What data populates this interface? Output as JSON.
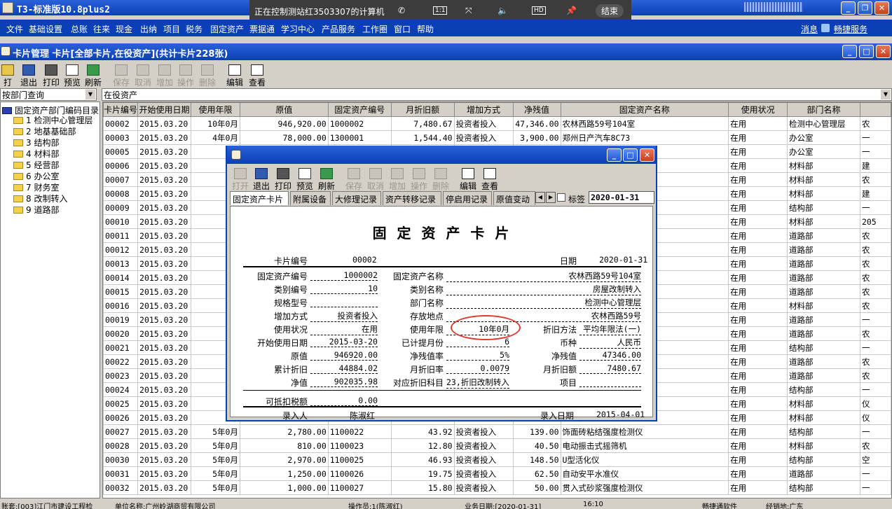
{
  "app": {
    "title": "T3-标准版10.8plus2"
  },
  "remote": {
    "text": "正在控制测站红3503307的计算机",
    "end": "结束"
  },
  "menu": [
    "文件",
    "基础设置",
    "总账",
    "往来",
    "现金",
    "出纳",
    "项目",
    "税务",
    "固定资产",
    "票据通",
    "学习中心",
    "产品服务",
    "工作圈",
    "窗口",
    "帮助"
  ],
  "menu_right": {
    "msg": "消息",
    "service": "畅捷服务"
  },
  "card_window": {
    "title": "卡片管理  卡片[全部卡片,在役资产](共计卡片228张)"
  },
  "toolbar": {
    "open": "打开",
    "exit": "退出",
    "print": "打印",
    "preview": "预览",
    "refresh": "刷新",
    "save": "保存",
    "cancel": "取消",
    "add": "增加",
    "operate": "操作",
    "delete": "删除",
    "edit": "编辑",
    "view": "查看"
  },
  "left_select": "按部门查询",
  "right_select": "在役资产",
  "tree": {
    "root": "固定资产部门编码目录",
    "items": [
      "1 检测中心管理层",
      "2 地基基础部",
      "3 结构部",
      "4 材料部",
      "5 经营部",
      "6 办公室",
      "7 财务室",
      "8 改制转入",
      "9 道路部"
    ]
  },
  "grid": {
    "headers": [
      "卡片编号",
      "开始使用日期",
      "使用年限",
      "原值",
      "固定资产编号",
      "月折旧额",
      "增加方式",
      "净残值",
      "固定资产名称",
      "使用状况",
      "部门名称",
      ""
    ],
    "rows": [
      [
        "00002",
        "2015.03.20",
        "10年0月",
        "946,920.00",
        "1000002",
        "7,480.67",
        "投资者投入",
        "47,346.00",
        "农林西路59号104室",
        "在用",
        "检测中心管理层",
        "农"
      ],
      [
        "00003",
        "2015.03.20",
        "4年0月",
        "78,000.00",
        "1300001",
        "1,544.40",
        "投资者投入",
        "3,900.00",
        "郑州日产汽车8C73",
        "在用",
        "办公室",
        "一"
      ],
      [
        "00005",
        "2015.03.20",
        "5年",
        "",
        "",
        "",
        "",
        "",
        "",
        "在用",
        "办公室",
        "一"
      ],
      [
        "00006",
        "2015.03.20",
        "5年",
        "",
        "",
        "",
        "",
        "",
        "",
        "在用",
        "材料部",
        "建"
      ],
      [
        "00007",
        "2015.03.20",
        "5年",
        "",
        "",
        "",
        "",
        "",
        "试验机",
        "在用",
        "材料部",
        "农"
      ],
      [
        "00008",
        "2015.03.20",
        "5年",
        "",
        "",
        "",
        "",
        "",
        "",
        "在用",
        "材料部",
        "建"
      ],
      [
        "00009",
        "2015.03.20",
        "5年",
        "",
        "",
        "",
        "",
        "",
        "测仪",
        "在用",
        "结构部",
        "一"
      ],
      [
        "00010",
        "2015.03.20",
        "5年",
        "",
        "",
        "",
        "",
        "",
        "比测试系统",
        "在用",
        "材料部",
        "205"
      ],
      [
        "00011",
        "2015.03.20",
        "5年",
        "",
        "",
        "",
        "",
        "",
        "",
        "在用",
        "道路部",
        "农"
      ],
      [
        "00012",
        "2015.03.20",
        "5年",
        "",
        "",
        "",
        "",
        "",
        "",
        "在用",
        "道路部",
        "农"
      ],
      [
        "00013",
        "2015.03.20",
        "5年",
        "",
        "",
        "",
        "",
        "",
        "",
        "在用",
        "道路部",
        "农"
      ],
      [
        "00014",
        "2015.03.20",
        "5年",
        "",
        "",
        "",
        "",
        "",
        "仪",
        "在用",
        "道路部",
        "农"
      ],
      [
        "00015",
        "2015.03.20",
        "5年",
        "",
        "",
        "",
        "",
        "",
        "箱",
        "在用",
        "道路部",
        "农"
      ],
      [
        "00016",
        "2015.03.20",
        "5年",
        "",
        "",
        "",
        "",
        "",
        "",
        "在用",
        "材料部",
        "农"
      ],
      [
        "00019",
        "2015.03.20",
        "5年",
        "",
        "",
        "",
        "",
        "",
        "(钻芯法)",
        "在用",
        "道路部",
        "一"
      ],
      [
        "00020",
        "2015.03.20",
        "5年",
        "",
        "",
        "",
        "",
        "",
        "",
        "在用",
        "道路部",
        "农"
      ],
      [
        "00021",
        "2015.03.20",
        "5年",
        "",
        "",
        "",
        "",
        "",
        "",
        "在用",
        "结构部",
        "一"
      ],
      [
        "00022",
        "2015.03.20",
        "5年",
        "",
        "",
        "",
        "",
        "",
        "",
        "在用",
        "道路部",
        "农"
      ],
      [
        "00023",
        "2015.03.20",
        "5年",
        "",
        "",
        "",
        "",
        "",
        "",
        "在用",
        "道路部",
        "农"
      ],
      [
        "00024",
        "2015.03.20",
        "5年",
        "",
        "",
        "",
        "",
        "",
        "检测仪",
        "在用",
        "结构部",
        "一"
      ],
      [
        "00025",
        "2015.03.20",
        "5年",
        "",
        "",
        "",
        "",
        "",
        "",
        "在用",
        "材料部",
        "仪"
      ],
      [
        "00026",
        "2015.03.20",
        "5年",
        "",
        "",
        "",
        "",
        "",
        "系数检定系统",
        "在用",
        "材料部",
        "仪"
      ],
      [
        "00027",
        "2015.03.20",
        "5年0月",
        "2,780.00",
        "1100022",
        "43.92",
        "投资者投入",
        "139.00",
        "饰面砖粘结强度检测仪",
        "在用",
        "结构部",
        "一"
      ],
      [
        "00028",
        "2015.03.20",
        "5年0月",
        "810.00",
        "1100023",
        "12.80",
        "投资者投入",
        "40.50",
        "电动振击式摇筛机",
        "在用",
        "材料部",
        "农"
      ],
      [
        "00030",
        "2015.03.20",
        "5年0月",
        "2,970.00",
        "1100025",
        "46.93",
        "投资者投入",
        "148.50",
        "U型活化仪",
        "在用",
        "结构部",
        "空"
      ],
      [
        "00031",
        "2015.03.20",
        "5年0月",
        "1,250.00",
        "1100026",
        "19.75",
        "投资者投入",
        "62.50",
        "自动安平水准仪",
        "在用",
        "道路部",
        "一"
      ],
      [
        "00032",
        "2015.03.20",
        "5年0月",
        "1,000.00",
        "1100027",
        "15.80",
        "投资者投入",
        "50.00",
        "贯入式砂浆强度检测仪",
        "在用",
        "结构部",
        "一"
      ]
    ]
  },
  "status": {
    "account": "账套:[003]江门市建设工程检",
    "company": "单位名称:广州岭湖商贸有限公司",
    "operator": "操作员:1(陈淑红)",
    "date": "业务日期:[2020-01-31]",
    "time": "16:10",
    "soft": "畅捷通软件",
    "dealer": "经销地:广东"
  },
  "dialog": {
    "tabs": [
      "固定资产卡片",
      "附属设备",
      "大修理记录",
      "资产转移记录",
      "停启用记录",
      "原值变动"
    ],
    "tag_label": "标签",
    "tag_date": "2020-01-31",
    "card_title": "固 定 资 产 卡 片",
    "card_no_label": "卡片编号",
    "card_no": "00002",
    "date_label": "日期",
    "date": "2020-01-31",
    "fields": {
      "asset_no_l": "固定资产编号",
      "asset_no": "1000002",
      "asset_name_l": "固定资产名称",
      "asset_name": "农林西路59号104室",
      "cat_no_l": "类别编号",
      "cat_no": "10",
      "cat_name_l": "类别名称",
      "cat_name": "房屋改制转入",
      "spec_l": "规格型号",
      "spec": "",
      "dept_l": "部门名称",
      "dept": "检测中心管理层",
      "add_l": "增加方式",
      "add": "投资者投入",
      "loc_l": "存放地点",
      "loc": "农林西路59号",
      "status_l": "使用状况",
      "status": "在用",
      "life_l": "使用年限",
      "life": "10年0月",
      "method_l": "折旧方法",
      "method": "平均年限法(一)",
      "start_l": "开始使用日期",
      "start": "2015-03-20",
      "months_l": "已计提月份",
      "months": "6",
      "cur_l": "币种",
      "cur": "人民币",
      "orig_l": "原值",
      "orig": "946920.00",
      "rate_l": "净残值率",
      "rate": "5%",
      "res_l": "净残值",
      "res": "47346.00",
      "acc_l": "累计折旧",
      "acc": "44884.02",
      "mrate_l": "月折旧率",
      "mrate": "0.0079",
      "mdep_l": "月折旧额",
      "mdep": "7480.67",
      "net_l": "净值",
      "net": "902035.98",
      "subj_l": "对应折旧科目",
      "subj": "23,折旧改制转入",
      "proj_l": "项目",
      "proj": "",
      "vat_l": "可抵扣税额",
      "vat": "0.00",
      "entry_l": "录入人",
      "entry": "陈淑红",
      "entry_date_l": "录入日期",
      "entry_date": "2015-04-01"
    }
  },
  "colors": {
    "titlebar": "#0b3fb6",
    "highlight_circle": "#e03a2f"
  }
}
